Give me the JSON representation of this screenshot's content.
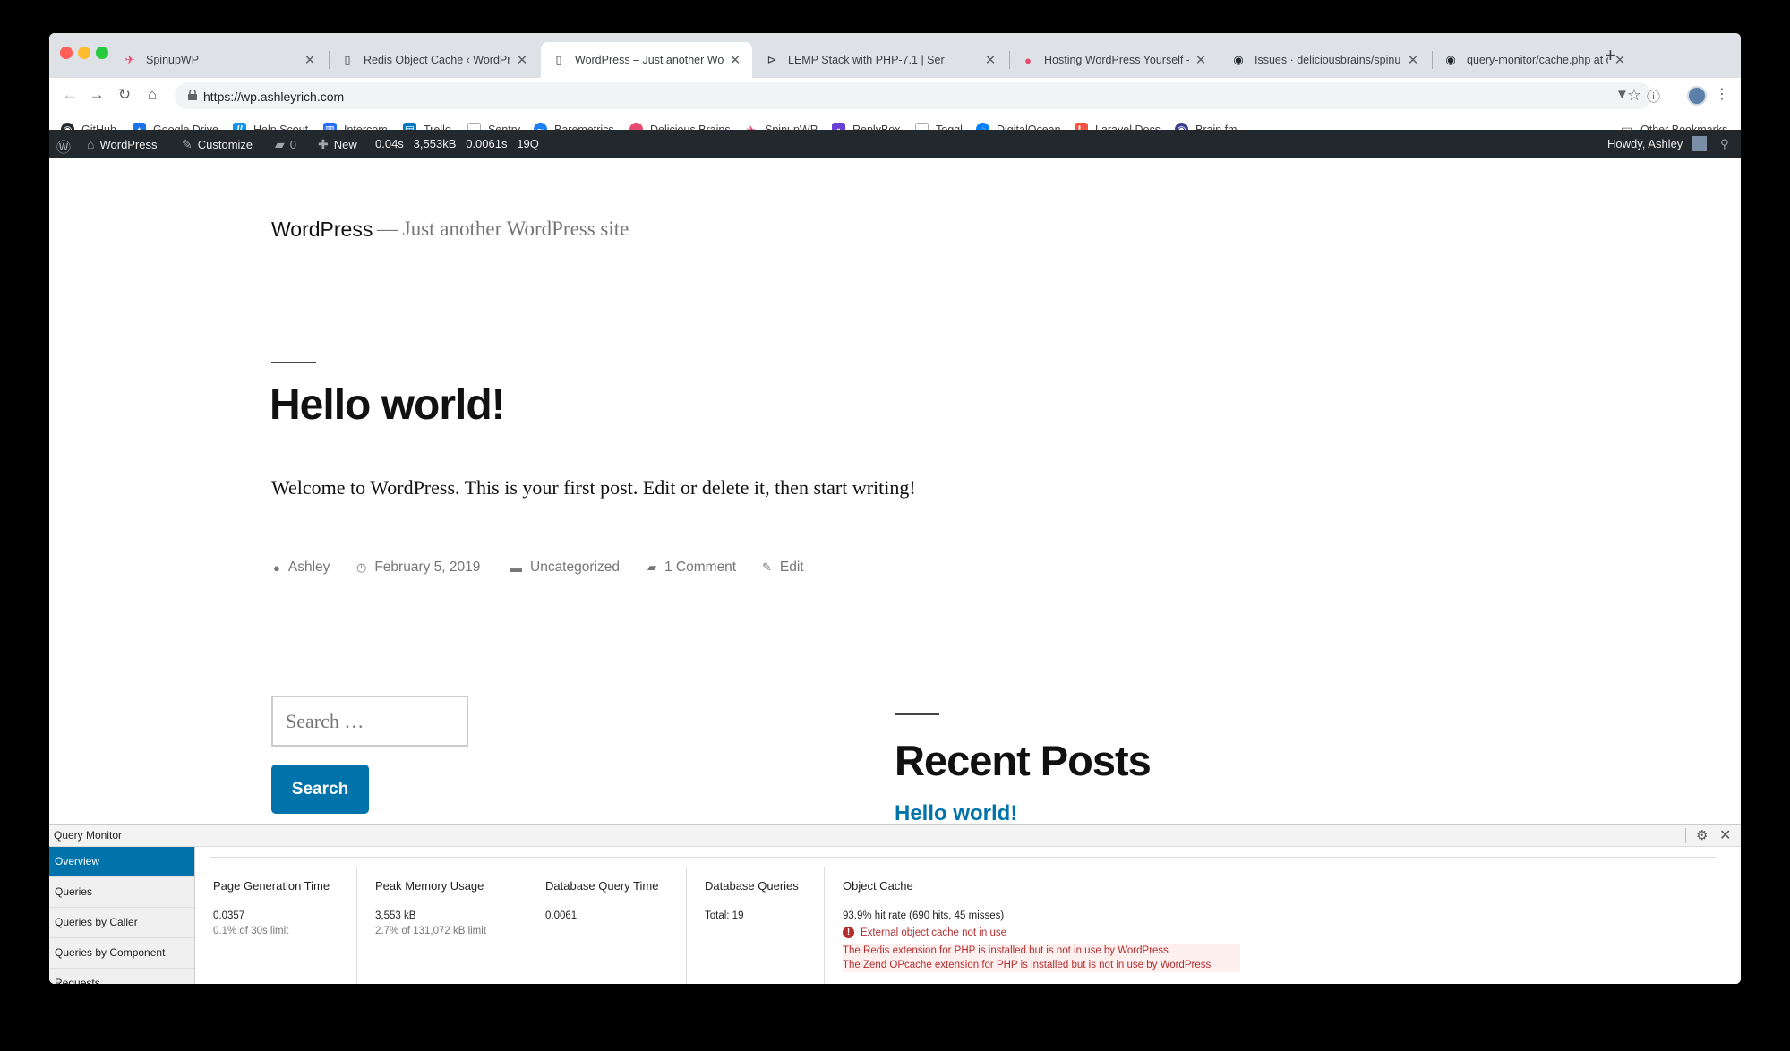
{
  "browser": {
    "tabs": [
      {
        "title": "SpinupWP",
        "icon": "spinupwp-icon",
        "active": false
      },
      {
        "title": "Redis Object Cache ‹ WordPre",
        "icon": "page-icon",
        "active": false
      },
      {
        "title": "WordPress – Just another Wor",
        "icon": "page-icon",
        "active": true
      },
      {
        "title": "LEMP Stack with PHP-7.1 | Ser",
        "icon": "play-icon",
        "active": false
      },
      {
        "title": "Hosting WordPress Yourself - ",
        "icon": "delicious-brains-icon",
        "active": false
      },
      {
        "title": "Issues · deliciousbrains/spinup",
        "icon": "github-icon",
        "active": false
      },
      {
        "title": "query-monitor/cache.php at c",
        "icon": "github-icon",
        "active": false
      }
    ],
    "url": "https://wp.ashleyrich.com",
    "bookmarks": [
      {
        "label": "GitHub",
        "icon": "github-icon",
        "color": "#24292e"
      },
      {
        "label": "Google Drive",
        "icon": "google-drive-icon",
        "color": "#1a73e8"
      },
      {
        "label": "Help Scout",
        "icon": "help-scout-icon",
        "color": "#1292ee"
      },
      {
        "label": "Intercom",
        "icon": "intercom-icon",
        "color": "#286efa"
      },
      {
        "label": "Trello",
        "icon": "trello-icon",
        "color": "#0079bf"
      },
      {
        "label": "Sentry",
        "icon": "page-icon",
        "color": "#888888"
      },
      {
        "label": "Baremetrics",
        "icon": "baremetrics-icon",
        "color": "#1a7ff0"
      },
      {
        "label": "Delicious Brains",
        "icon": "delicious-brains-icon",
        "color": "#e84a6f"
      },
      {
        "label": "SpinupWP",
        "icon": "spinupwp-icon",
        "color": "#e84a6f"
      },
      {
        "label": "ReplyBox",
        "icon": "replybox-icon",
        "color": "#6a3fd6"
      },
      {
        "label": "Toggl",
        "icon": "page-icon",
        "color": "#888888"
      },
      {
        "label": "DigitalOcean",
        "icon": "digitalocean-icon",
        "color": "#0080ff"
      },
      {
        "label": "Laravel Docs",
        "icon": "laravel-icon",
        "color": "#f4533f"
      },
      {
        "label": "Brain.fm",
        "icon": "brainfm-icon",
        "color": "#3b3f8f"
      }
    ],
    "other_bookmarks": "Other Bookmarks"
  },
  "adminbar": {
    "site_name": "WordPress",
    "customize": "Customize",
    "comments_count": "0",
    "new_label": "New",
    "qm_time": "0.04s",
    "qm_memory": "3,553kB",
    "qm_db_time": "0.0061s",
    "qm_queries": "19Q",
    "howdy": "Howdy, Ashley"
  },
  "site": {
    "title": "WordPress",
    "tagline": "— Just another WordPress site"
  },
  "post": {
    "title": "Hello world!",
    "body": "Welcome to WordPress. This is your first post. Edit or delete it, then start writing!",
    "author": "Ashley",
    "date": "February 5, 2019",
    "category": "Uncategorized",
    "comments": "1 Comment",
    "edit": "Edit"
  },
  "sidebar": {
    "search_placeholder": "Search …",
    "search_button": "Search",
    "recent_posts_title": "Recent Posts",
    "recent_posts": [
      "Hello world!"
    ]
  },
  "query_monitor": {
    "title": "Query Monitor",
    "nav": [
      "Overview",
      "Queries",
      "Queries by Caller",
      "Queries by Component",
      "Requests"
    ],
    "active_nav": "Overview",
    "page_generation": {
      "heading": "Page Generation Time",
      "value": "0.0357",
      "sub": "0.1% of 30s limit"
    },
    "peak_memory": {
      "heading": "Peak Memory Usage",
      "value": "3,553 kB",
      "sub": "2.7% of 131,072 kB limit"
    },
    "db_query_time": {
      "heading": "Database Query Time",
      "value": "0.0061"
    },
    "db_queries": {
      "heading": "Database Queries",
      "value": "Total: 19"
    },
    "object_cache": {
      "heading": "Object Cache",
      "value": "93.9% hit rate (690 hits, 45 misses)",
      "error": "External object cache not in use",
      "warnings": [
        "The Redis extension for PHP is installed but is not in use by WordPress",
        "The Zend OPcache extension for PHP is installed but is not in use by WordPress"
      ]
    }
  },
  "colors": {
    "wp_blue": "#0073aa",
    "adminbar_bg": "#23282d",
    "error_red": "#b32d2e"
  }
}
